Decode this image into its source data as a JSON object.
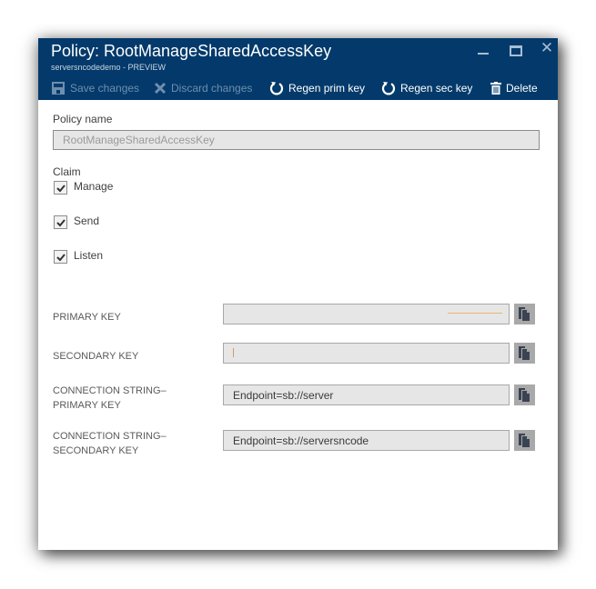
{
  "window": {
    "title": "Policy: RootManageSharedAccessKey",
    "subtitle": "serversncodedemo - PREVIEW",
    "controls": {
      "minimize": "minimize-icon",
      "maximize": "maximize-icon",
      "close": "close-icon",
      "close_glyph": "✕"
    }
  },
  "toolbar": {
    "save_label": "Save changes",
    "discard_label": "Discard changes",
    "regen_primary_label": "Regen prim key",
    "regen_secondary_label": "Regen sec key",
    "delete_label": "Delete",
    "save_enabled": false,
    "discard_enabled": false
  },
  "form": {
    "policy_name_label": "Policy name",
    "policy_name_value": "RootManageSharedAccessKey",
    "claim_label": "Claim",
    "claims": [
      {
        "label": "Manage",
        "checked": true
      },
      {
        "label": "Send",
        "checked": true
      },
      {
        "label": "Listen",
        "checked": true
      }
    ],
    "keys": [
      {
        "label_line1": "PRIMARY KEY",
        "label_line2": "",
        "value": ""
      },
      {
        "label_line1": "SECONDARY KEY",
        "label_line2": "",
        "value": ""
      },
      {
        "label_line1": "CONNECTION STRING–",
        "label_line2": "PRIMARY KEY",
        "value": "Endpoint=sb://server"
      },
      {
        "label_line1": "CONNECTION STRING–",
        "label_line2": "SECONDARY KEY",
        "value": "Endpoint=sb://serversncode"
      }
    ]
  },
  "colors": {
    "header_bg": "#033a6b",
    "field_bg": "#e6e6e6",
    "copy_button_bg": "#a9a9a9",
    "accent_orange": "#e7b86a"
  }
}
